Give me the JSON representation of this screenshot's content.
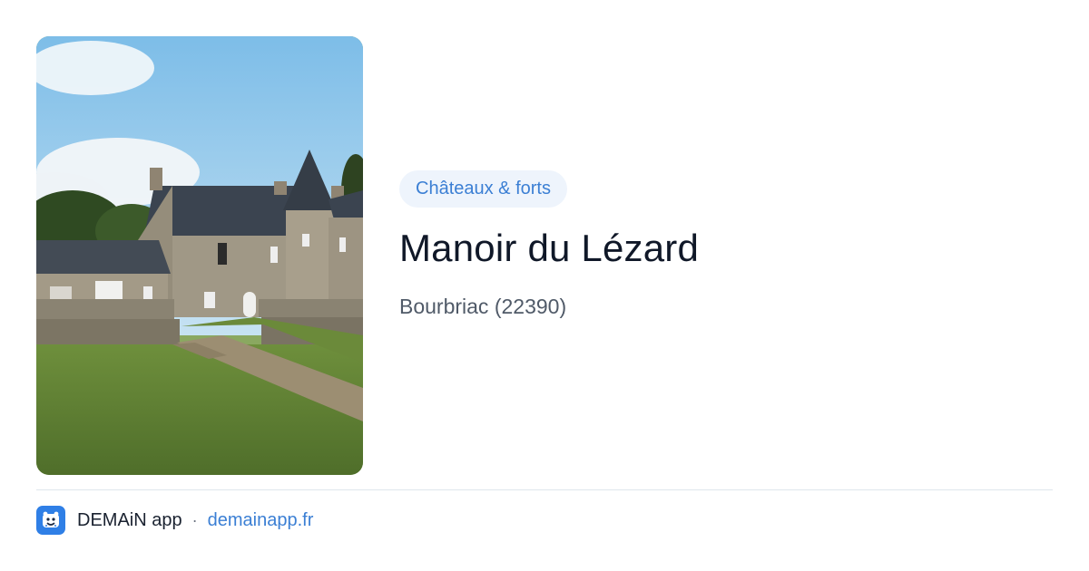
{
  "card": {
    "category": "Châteaux & forts",
    "title": "Manoir du Lézard",
    "location": "Bourbriac (22390)"
  },
  "footer": {
    "app_name": "DEMAiN app",
    "separator": "·",
    "url": "demainapp.fr"
  },
  "colors": {
    "accent": "#3b7fd4",
    "chip_bg": "#eef4fc",
    "title": "#101828",
    "muted": "#505a68",
    "app_icon": "#2f7fe6"
  },
  "icons": {
    "app": "demain-app-logo-icon"
  }
}
